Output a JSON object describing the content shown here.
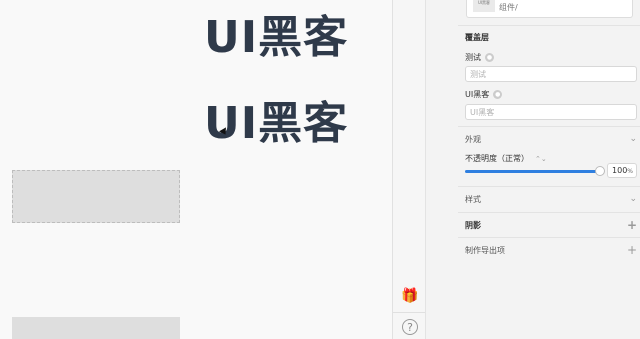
{
  "canvas": {
    "text_top": "UI黑客",
    "text_bottom": "UI黑客"
  },
  "symbol": {
    "thumb_label": "UI黑客",
    "path": "组件/"
  },
  "overrides": {
    "heading": "覆盖层",
    "items": [
      {
        "label": "测试",
        "placeholder": "测试"
      },
      {
        "label": "UI黑客",
        "placeholder": "UI黑客"
      }
    ]
  },
  "appearance": {
    "heading": "外观",
    "opacity_label": "不透明度（正常）",
    "opacity_value": "100",
    "opacity_unit": "%",
    "opacity_fraction": 1.0
  },
  "style": {
    "heading": "样式"
  },
  "shadow": {
    "heading": "阴影"
  },
  "export": {
    "heading": "制作导出项"
  },
  "icons": {
    "gift": "gift-icon",
    "help": "help-icon",
    "eye": "eye-icon",
    "chevron": "chevron-down-icon",
    "plus": "plus-icon",
    "stepper": "stepper-icon"
  },
  "colors": {
    "accent": "#2f7fe0",
    "text_dark": "#2f3a4a"
  }
}
